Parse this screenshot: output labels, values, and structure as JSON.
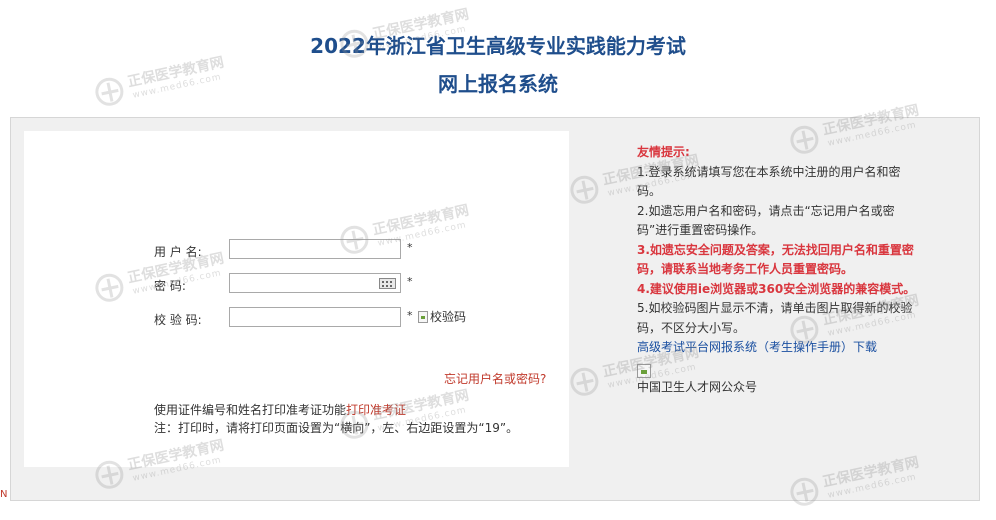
{
  "header": {
    "title_line1": "2022年浙江省卫生高级专业实践能力考试",
    "title_line2": "网上报名系统"
  },
  "form": {
    "username_label": "用 户 名:",
    "password_label": "密    码:",
    "captcha_label": "校 验 码:",
    "required_mark": "*",
    "captcha_alt": "校验码",
    "forgot_link": "忘记用户名或密码?",
    "print_text": "使用证件编号和姓名打印准考证功能",
    "print_link": "打印准考证",
    "note_text": "注：打印时，请将打印页面设置为“横向”，左、右边距设置为“19”。"
  },
  "tips": {
    "heading": "友情提示:",
    "item1": "1.登录系统请填写您在本系统中注册的用户名和密码。",
    "item2": "2.如遗忘用户名和密码，请点击“忘记用户名或密码”进行重置密码操作。",
    "item3": "3.如遗忘安全问题及答案，无法找回用户名和重置密码，请联系当地考务工作人员重置密码。",
    "item4": "4.建议使用ie浏览器或360安全浏览器的兼容模式。",
    "item5": "5.如校验码图片显示不清，请单击图片取得新的校验码，不区分大小写。",
    "manual_link": "高级考试平台网报系统（考生操作手册）下载",
    "wechat_caption": "中国卫生人才网公众号"
  },
  "watermark": {
    "brand": "正保医学教育网",
    "url": "www.med66.com"
  },
  "corner_text": "N"
}
